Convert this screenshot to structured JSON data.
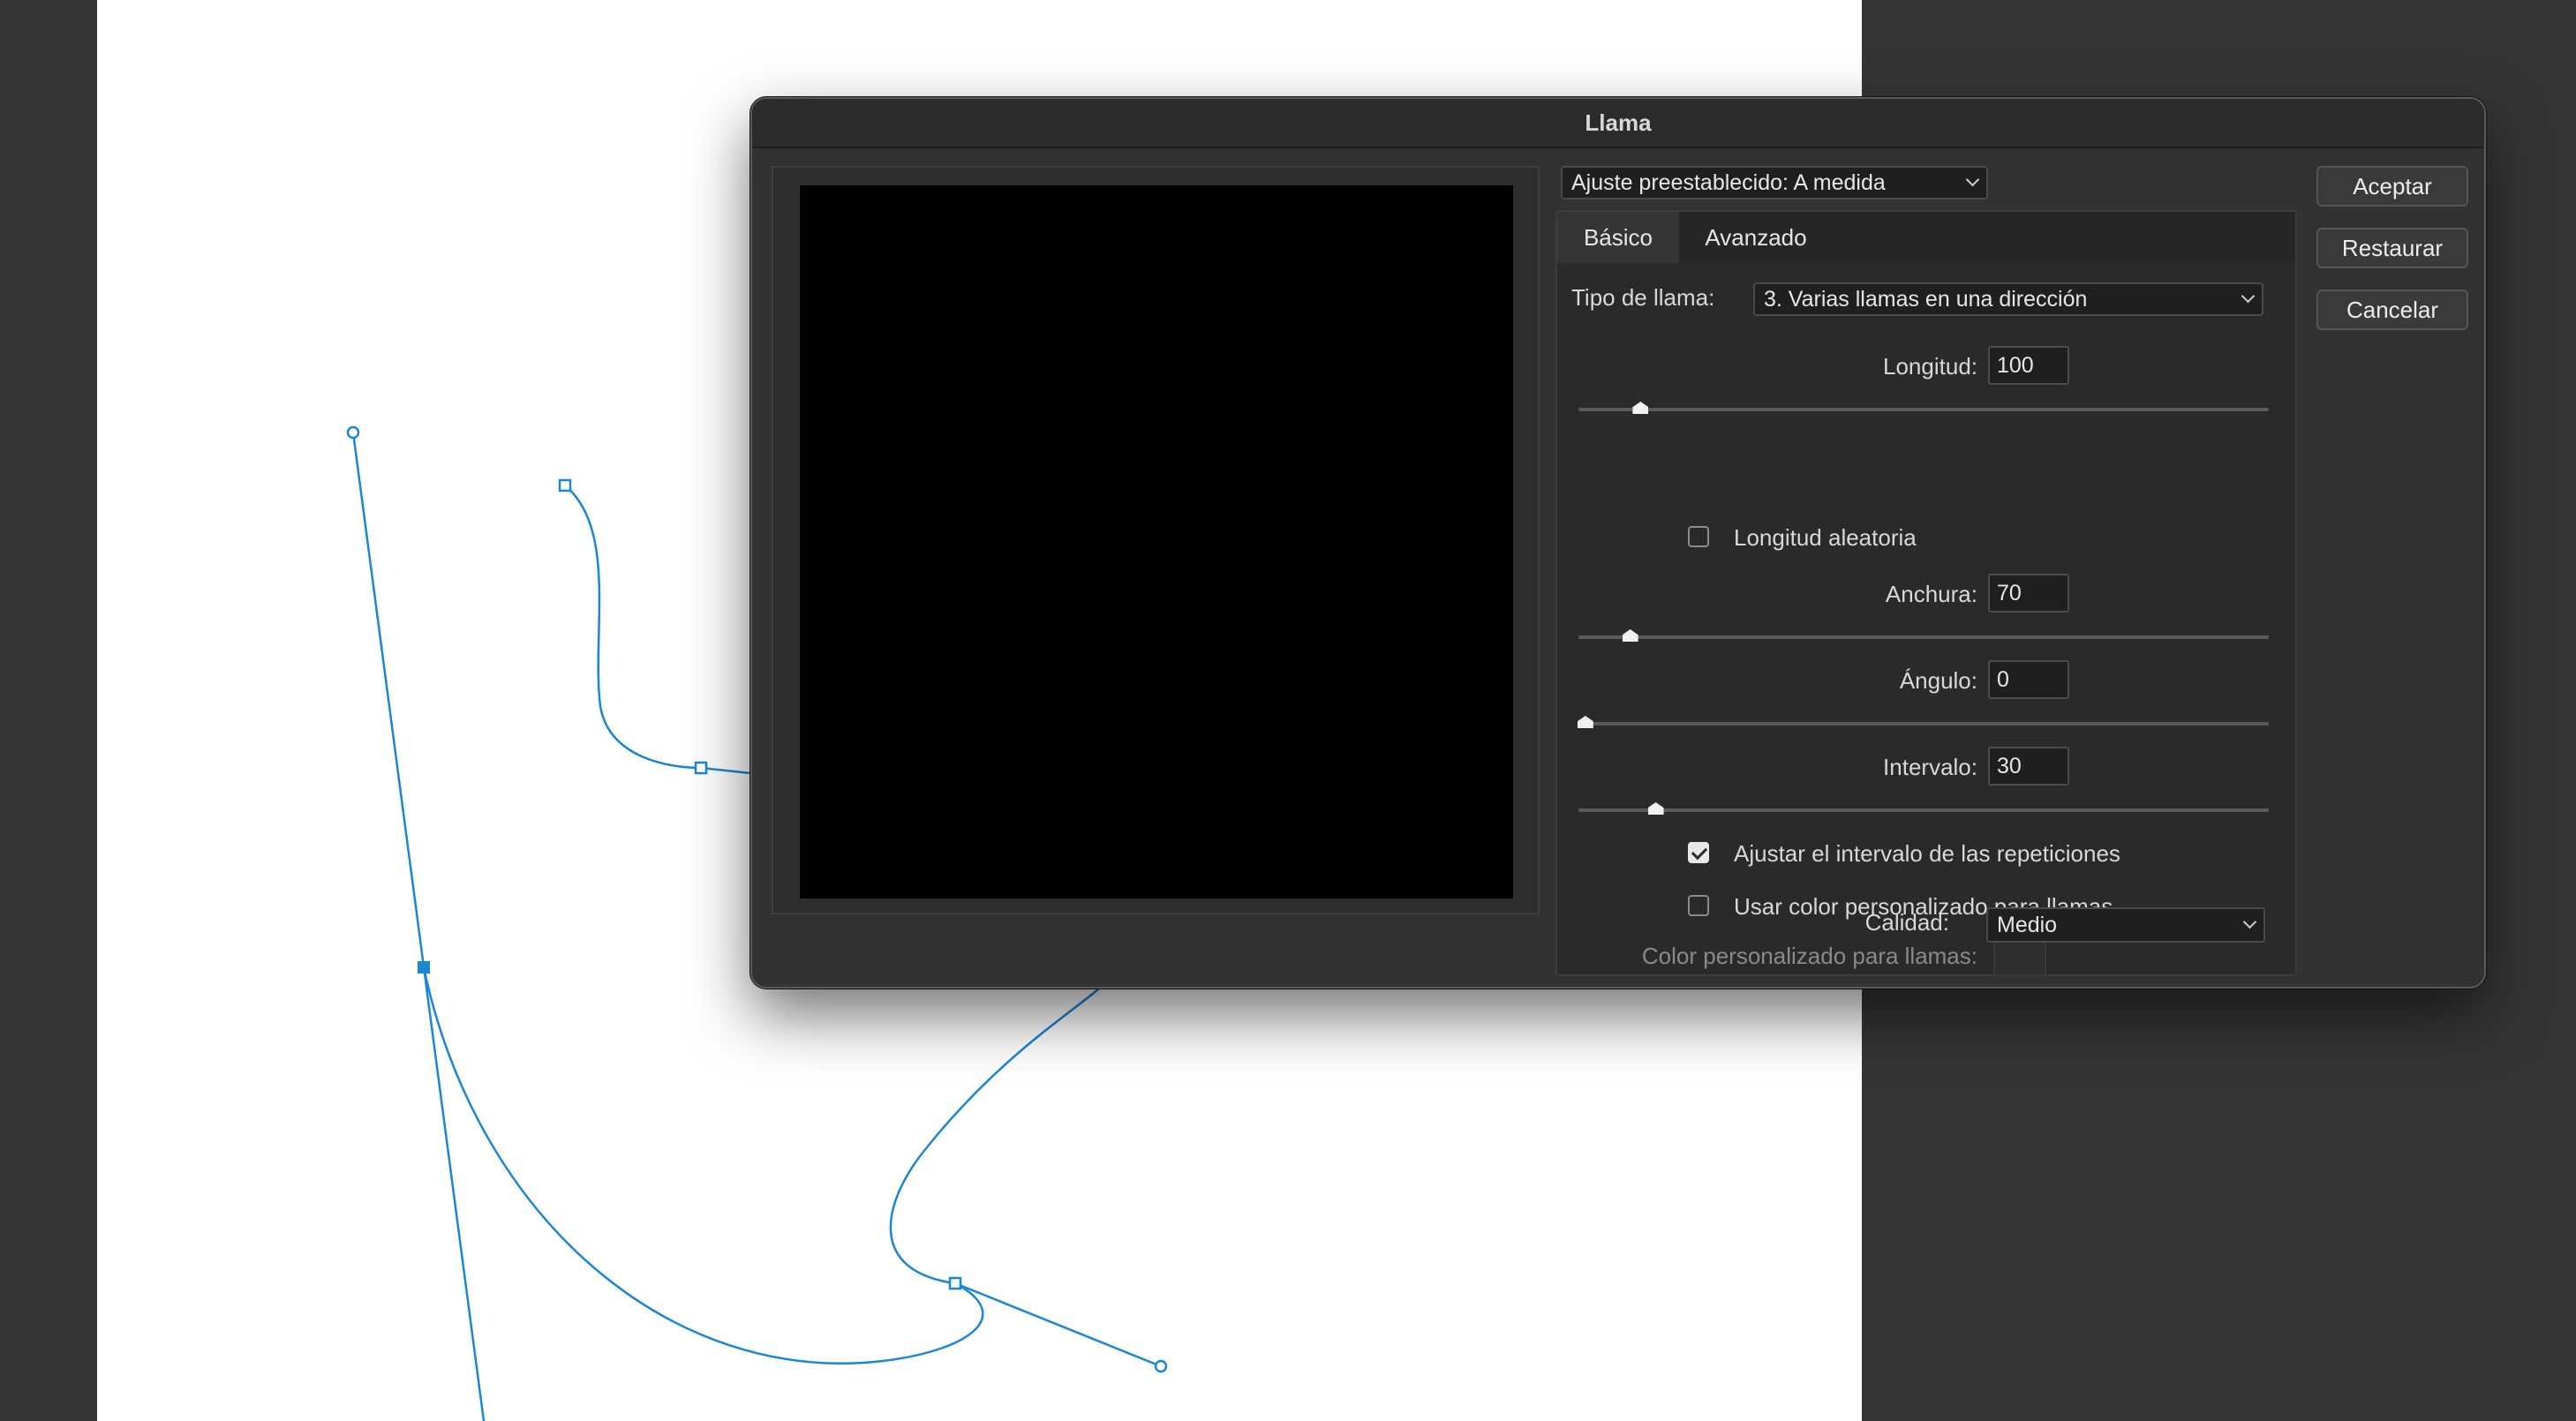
{
  "dialog": {
    "title": "Llama",
    "preset": {
      "label": "Ajuste preestablecido:",
      "value": "A medida",
      "text": "Ajuste preestablecido: A medida"
    },
    "buttons": {
      "ok": "Aceptar",
      "reset": "Restaurar",
      "cancel": "Cancelar"
    },
    "tabs": [
      "Básico",
      "Avanzado"
    ],
    "active_tab": "Básico",
    "flame_type": {
      "label": "Tipo de llama:",
      "value": "3. Varias llamas en una dirección"
    },
    "length": {
      "label": "Longitud:",
      "value": "100",
      "slider_fraction": 0.09
    },
    "random_length": {
      "label": "Longitud aleatoria",
      "checked": false
    },
    "width": {
      "label": "Anchura:",
      "value": "70",
      "slider_fraction": 0.075
    },
    "angle": {
      "label": "Ángulo:",
      "value": "0",
      "slider_fraction": 0.01
    },
    "interval": {
      "label": "Intervalo:",
      "value": "30",
      "slider_fraction": 0.112
    },
    "adjust_interval": {
      "label": "Ajustar el intervalo de las repeticiones",
      "checked": true
    },
    "custom_color": {
      "label": "Usar color personalizado para llamas",
      "checked": false
    },
    "custom_color_field": {
      "label": "Color personalizado para llamas:"
    },
    "quality": {
      "label": "Calidad:",
      "value": "Medio"
    }
  },
  "colors": {
    "path": "#1a86d8",
    "dialog_bg": "#323232",
    "preview_bg": "#000000",
    "document_bg": "#ffffff",
    "workspace_bg": "#353535"
  }
}
